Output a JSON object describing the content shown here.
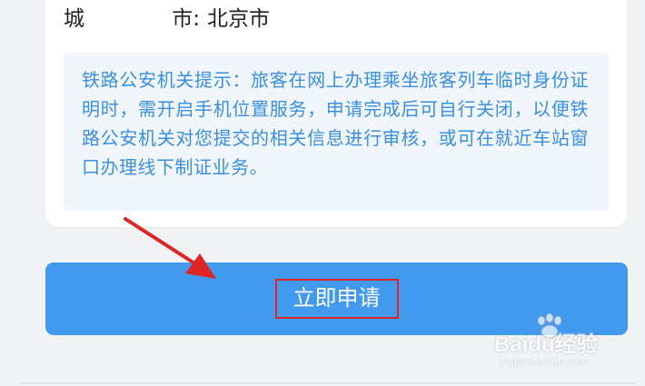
{
  "form": {
    "city_label_left": "城",
    "city_label_right": "市:",
    "city_value": "北京市"
  },
  "notice": {
    "text": "铁路公安机关提示：旅客在网上办理乘坐旅客列车临时身份证明时，需开启手机位置服务，申请完成后可自行关闭，以便铁路公安机关对您提交的相关信息进行审核，或可在就近车站窗口办理线下制证业务。"
  },
  "actions": {
    "apply_label": "立即申请"
  },
  "watermark": {
    "brand": "Baidu经验",
    "sub": "jingyan.baidu.com"
  },
  "colors": {
    "button": "#429aef",
    "notice_text": "#3a8fe0",
    "notice_bg": "#f1f6fc",
    "annotation": "#e02424"
  }
}
